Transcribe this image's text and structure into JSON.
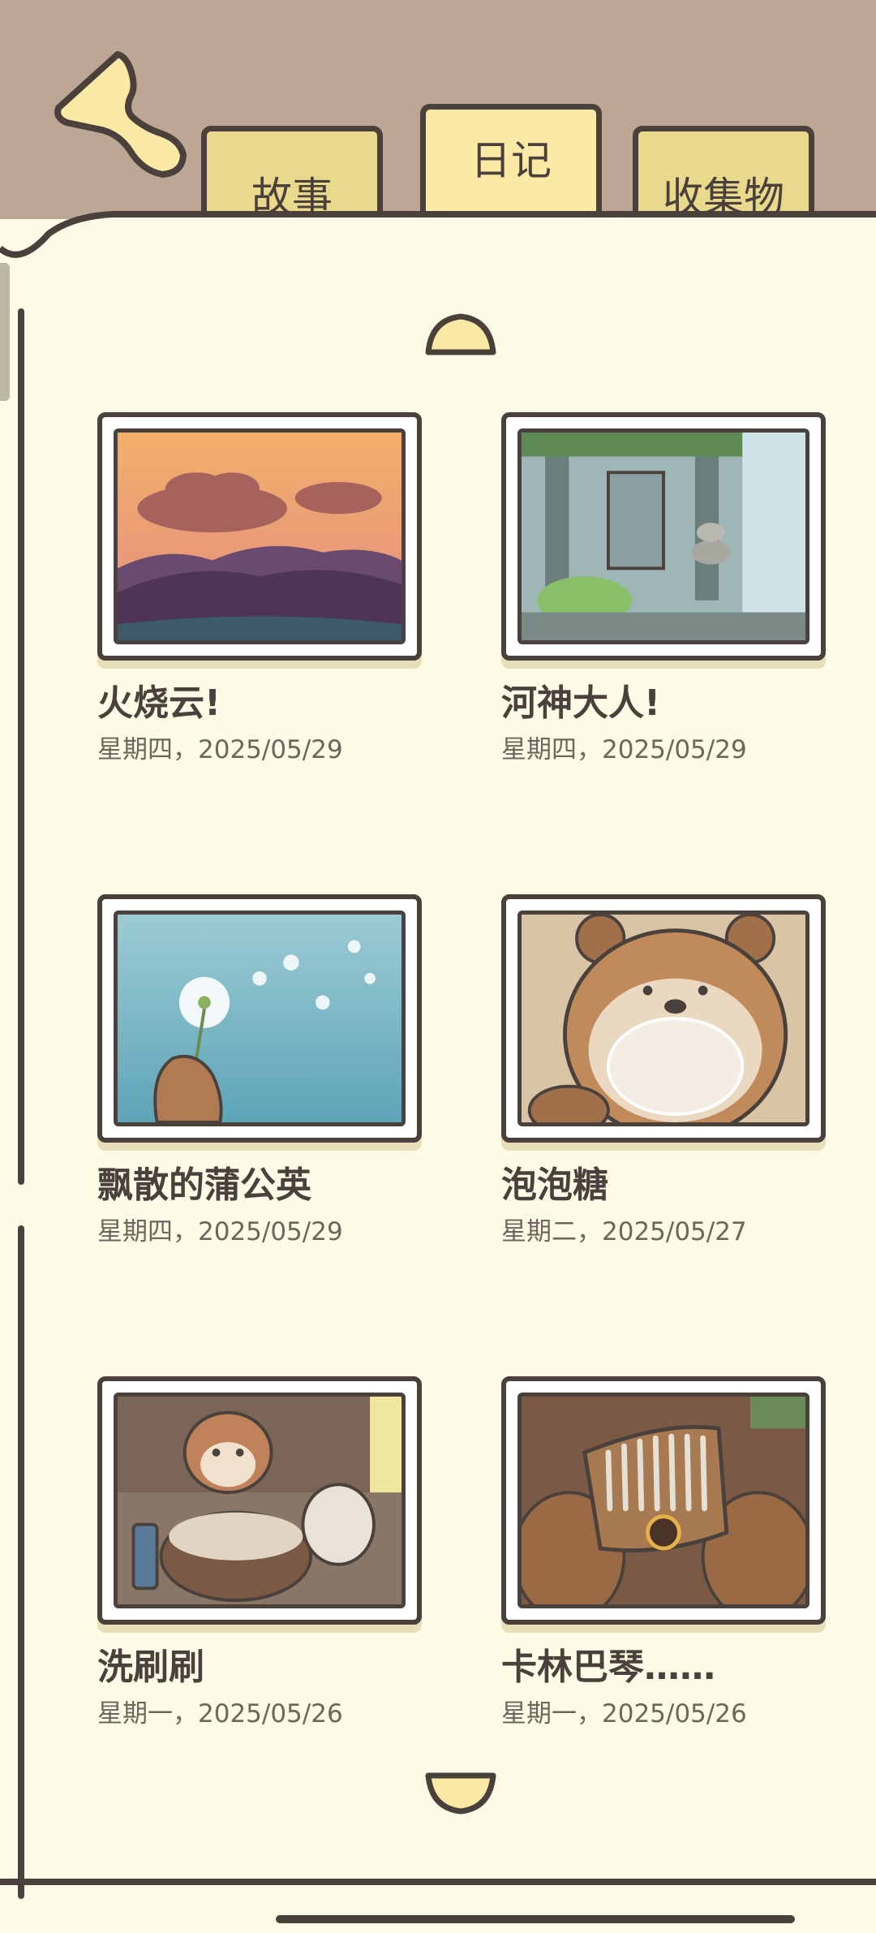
{
  "tabs": [
    {
      "label": "故事",
      "active": false
    },
    {
      "label": "日记",
      "active": true
    },
    {
      "label": "收集物",
      "active": false
    }
  ],
  "entries": [
    {
      "title": "火烧云!",
      "date": "星期四，2025/05/29",
      "image": "sunset-clouds"
    },
    {
      "title": "河神大人!",
      "date": "星期四，2025/05/29",
      "image": "river-shrine"
    },
    {
      "title": "飘散的蒲公英",
      "date": "星期四，2025/05/29",
      "image": "dandelion"
    },
    {
      "title": "泡泡糖",
      "date": "星期二，2025/05/27",
      "image": "bubblegum-bear"
    },
    {
      "title": "洗刷刷",
      "date": "星期一，2025/05/26",
      "image": "washing-chipmunk"
    },
    {
      "title": "卡林巴琴……",
      "date": "星期一，2025/05/26",
      "image": "kalimba"
    }
  ],
  "colors": {
    "header_bg": "#bda693",
    "paper": "#fefbe6",
    "tab": "#e9d98c",
    "tab_active": "#fbe9a6",
    "outline": "#4a413c"
  }
}
